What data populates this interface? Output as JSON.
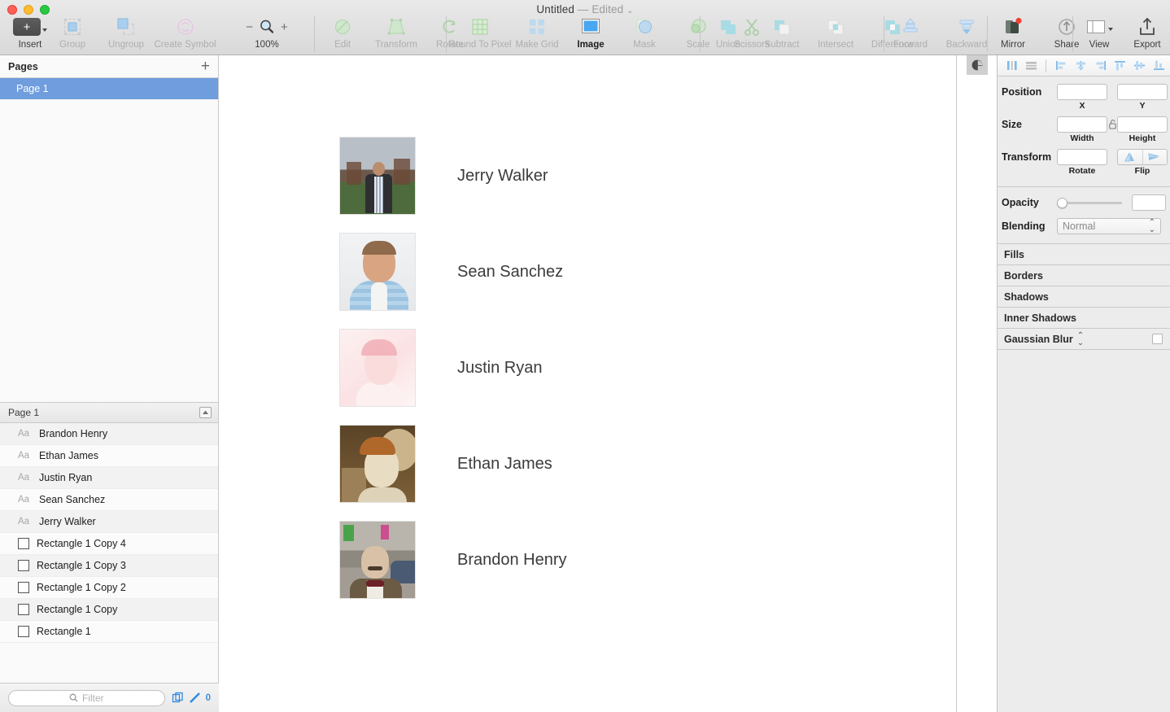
{
  "window": {
    "title": "Untitled",
    "separator": "—",
    "state": "Edited",
    "chevron": "⌄"
  },
  "toolbar": {
    "groups": [
      {
        "items": [
          {
            "label": "Insert",
            "icon": "plus-icon",
            "enabled": true
          }
        ]
      },
      {
        "items": [
          {
            "label": "Group",
            "icon": "group-icon",
            "enabled": false
          },
          {
            "label": "Ungroup",
            "icon": "ungroup-icon",
            "enabled": false
          }
        ]
      },
      {
        "items": [
          {
            "label": "Create Symbol",
            "icon": "create-symbol-icon",
            "enabled": false
          }
        ]
      },
      {
        "items": [
          {
            "label": "100%",
            "icon": "magnifier-icon",
            "minus": "−",
            "plus": "+",
            "enabled": true
          }
        ]
      },
      {
        "items": [
          {
            "label": "Edit",
            "icon": "edit-icon",
            "enabled": false
          },
          {
            "label": "Transform",
            "icon": "transform-icon",
            "enabled": false
          },
          {
            "label": "Rotate",
            "icon": "rotate-icon",
            "enabled": false
          }
        ]
      },
      {
        "items": [
          {
            "label": "Round To Pixel",
            "icon": "round-to-pixel-icon",
            "enabled": false
          },
          {
            "label": "Make Grid",
            "icon": "make-grid-icon",
            "enabled": false
          },
          {
            "label": "Image",
            "icon": "image-icon",
            "enabled": true
          },
          {
            "label": "Mask",
            "icon": "mask-icon",
            "enabled": false
          },
          {
            "label": "Scale",
            "icon": "scale-icon",
            "enabled": false
          },
          {
            "label": "Scissors",
            "icon": "scissors-icon",
            "enabled": false
          }
        ]
      },
      {
        "items": [
          {
            "label": "Union",
            "icon": "union-icon",
            "enabled": false
          },
          {
            "label": "Subtract",
            "icon": "subtract-icon",
            "enabled": false
          },
          {
            "label": "Intersect",
            "icon": "intersect-icon",
            "enabled": false
          },
          {
            "label": "Difference",
            "icon": "difference-icon",
            "enabled": false
          }
        ]
      },
      {
        "items": [
          {
            "label": "Forward",
            "icon": "forward-icon",
            "enabled": false
          },
          {
            "label": "Backward",
            "icon": "backward-icon",
            "enabled": false
          }
        ]
      },
      {
        "items": [
          {
            "label": "Mirror",
            "icon": "mirror-icon",
            "enabled": true,
            "badge": true
          },
          {
            "label": "Share",
            "icon": "share-icon",
            "enabled": true
          }
        ]
      },
      {
        "items": [
          {
            "label": "View",
            "icon": "view-icon",
            "enabled": true
          }
        ]
      },
      {
        "items": [
          {
            "label": "Export",
            "icon": "export-icon",
            "enabled": true
          }
        ]
      }
    ]
  },
  "sidebar": {
    "pages_header": "Pages",
    "add_page_icon": "plus-icon",
    "pages": [
      {
        "name": "Page 1",
        "selected": true
      }
    ],
    "layers_header": "Page 1",
    "collapse_icon": "collapse-icon",
    "layers": [
      {
        "name": "Brandon Henry",
        "type": "text",
        "icon": "text-layer-icon"
      },
      {
        "name": "Ethan James",
        "type": "text",
        "icon": "text-layer-icon"
      },
      {
        "name": "Justin Ryan",
        "type": "text",
        "icon": "text-layer-icon"
      },
      {
        "name": "Sean Sanchez",
        "type": "text",
        "icon": "text-layer-icon"
      },
      {
        "name": "Jerry Walker",
        "type": "text",
        "icon": "text-layer-icon"
      },
      {
        "name": "Rectangle 1 Copy 4",
        "type": "shape",
        "icon": "rectangle-layer-icon"
      },
      {
        "name": "Rectangle 1 Copy 3",
        "type": "shape",
        "icon": "rectangle-layer-icon"
      },
      {
        "name": "Rectangle 1 Copy 2",
        "type": "shape",
        "icon": "rectangle-layer-icon"
      },
      {
        "name": "Rectangle 1 Copy",
        "type": "shape",
        "icon": "rectangle-layer-icon"
      },
      {
        "name": "Rectangle 1",
        "type": "shape",
        "icon": "rectangle-layer-icon"
      }
    ],
    "filter": {
      "placeholder": "Filter",
      "value": "",
      "icon": "search-icon"
    },
    "footer_icons": [
      "duplicate-icon",
      "pencil-icon"
    ],
    "footer_count": "0"
  },
  "canvas": {
    "cards": [
      {
        "name": "Jerry Walker",
        "photo": "man-outdoors-industrial-park"
      },
      {
        "name": "Sean Sanchez",
        "photo": "man-blue-striped-shirt-studio"
      },
      {
        "name": "Justin Ryan",
        "photo": "high-key-pink-portrait"
      },
      {
        "name": "Ethan James",
        "photo": "sepia-portrait-looking-up"
      },
      {
        "name": "Brandon Henry",
        "photo": "bald-man-bowtie-street"
      }
    ]
  },
  "inspector": {
    "align_icons": [
      "align-vertical-left-icon",
      "align-vertical-center-icon",
      "align-left-icon",
      "align-horizontal-center-icon",
      "align-right-icon",
      "align-top-icon",
      "align-middle-icon",
      "align-bottom-icon"
    ],
    "position": {
      "label": "Position",
      "x": {
        "value": "",
        "sub": "X"
      },
      "y": {
        "value": "",
        "sub": "Y"
      }
    },
    "size": {
      "label": "Size",
      "width": {
        "value": "",
        "sub": "Width"
      },
      "height": {
        "value": "",
        "sub": "Height"
      },
      "lock_icon": "unlock-icon"
    },
    "transform": {
      "label": "Transform",
      "rotate": {
        "value": "",
        "sub": "Rotate"
      },
      "flip": {
        "sub": "Flip",
        "horizontal_icon": "flip-horizontal-icon",
        "vertical_icon": "flip-vertical-icon"
      }
    },
    "opacity": {
      "label": "Opacity",
      "value": "",
      "slider_percent": 0
    },
    "blending": {
      "label": "Blending",
      "value": "Normal",
      "stepper_icon": "stepper-icon"
    },
    "sections": [
      {
        "name": "Fills",
        "has_stepper": false,
        "has_checkbox": false
      },
      {
        "name": "Borders",
        "has_stepper": false,
        "has_checkbox": false
      },
      {
        "name": "Shadows",
        "has_stepper": false,
        "has_checkbox": false
      },
      {
        "name": "Inner Shadows",
        "has_stepper": false,
        "has_checkbox": false
      },
      {
        "name": "Gaussian Blur",
        "has_stepper": true,
        "has_checkbox": true
      }
    ]
  },
  "colors": {
    "selection_blue": "#6f9ddd",
    "accent_blue": "#3e8fe0",
    "toolbar_bg": "#e4e4e4",
    "inspector_bg": "#ececec"
  }
}
